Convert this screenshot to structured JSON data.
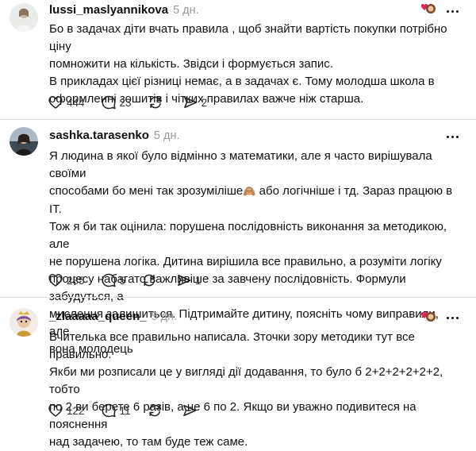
{
  "posts": [
    {
      "username": "lussi_maslyannikova",
      "time": "5 дн.",
      "lines": [
        "Бо в задачах діти вчать правила , щоб знайти вартість покупки потрібно ціну",
        "помножити на кількість. Звідси і формується запис.",
        "В прикладах цієї різниці немає, а в задачах є. Тому молодша школа в",
        "оформленні зошитів і чітких правилах важче ніж старша."
      ],
      "likes": "444",
      "comments": "23",
      "reposts": "",
      "shares": "2",
      "has_sticker": true
    },
    {
      "username": "sashka.tarasenko",
      "time": "5 дн.",
      "lines": [
        "Я людина в якої було відмінно з математики, але я часто вирішувала своїми",
        "способами бо мені так зрозуміліше",
        "або логічніше і тд. Зараз працюю в ІТ.",
        "Тож я би так оцінила: порушена послідовність виконання за методикою, але",
        "не порушена логіка. Дитина вирішила все правильно, а розуміти логіку",
        "процесу набагато важливіше за завчену послідовність. Формули забудуться, а",
        "мислення залишиться. Підтримайте дитину, поясніть чому виправили, але",
        "вона молодець"
      ],
      "emoji": "🙈",
      "likes": "285",
      "comments": "5",
      "reposts": "",
      "shares": "1",
      "has_sticker": false
    },
    {
      "username": "_zlaaaaa_queen_",
      "time": "5 дн.",
      "lines": [
        "Вчителька все правильно написала. Зточки зору методики тут все правильно.",
        "Якби ми розписали це у вигляді дії додавання, то було б 2+2+2+2+2+2, тобто",
        "по 2 ви берете 6 разів, а не 6 по 2. Якщо ви уважно подивитеся на пояснення",
        "над задачею, то там буде теж саме."
      ],
      "likes": "122",
      "comments": "11",
      "reposts": "",
      "shares": "",
      "has_sticker": true
    }
  ]
}
